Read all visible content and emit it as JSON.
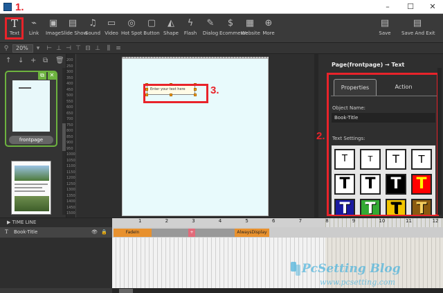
{
  "toolbar": {
    "items": [
      {
        "label": "Text",
        "icon": "text-icon",
        "glyph": "T"
      },
      {
        "label": "Link",
        "icon": "link-icon",
        "glyph": "⌁"
      },
      {
        "label": "Image",
        "icon": "image-icon",
        "glyph": "▣"
      },
      {
        "label": "Slide Show",
        "icon": "slideshow-icon",
        "glyph": "▤"
      },
      {
        "label": "Sound",
        "icon": "sound-icon",
        "glyph": "♫"
      },
      {
        "label": "Video",
        "icon": "video-icon",
        "glyph": "▭"
      },
      {
        "label": "Hot Spot",
        "icon": "hotspot-icon",
        "glyph": "◎"
      },
      {
        "label": "Button",
        "icon": "button-icon",
        "glyph": "▢"
      },
      {
        "label": "Shape",
        "icon": "shape-icon",
        "glyph": "◭"
      },
      {
        "label": "Flash",
        "icon": "flash-icon",
        "glyph": "ϟ"
      },
      {
        "label": "Dialog",
        "icon": "dialog-icon",
        "glyph": "✎"
      },
      {
        "label": "Ecommerce",
        "icon": "dollar-icon",
        "glyph": "$"
      },
      {
        "label": "Website",
        "icon": "website-icon",
        "glyph": "▦"
      },
      {
        "label": "More",
        "icon": "more-icon",
        "glyph": "⊕"
      }
    ],
    "save": {
      "label": "Save",
      "glyph": "▤"
    },
    "save_exit": {
      "label": "Save And Exit",
      "glyph": "▤"
    }
  },
  "window": {
    "minimize": "–",
    "maximize": "☐",
    "close": "✕"
  },
  "zoom": {
    "value": "20%"
  },
  "annotations": {
    "n1": "1.",
    "n2": "2.",
    "n3": "3."
  },
  "pages": {
    "page1_name": "frontpage"
  },
  "ruler_v": [
    "200",
    "250",
    "300",
    "350",
    "400",
    "450",
    "500",
    "550",
    "600",
    "650",
    "700",
    "750",
    "800",
    "850",
    "900",
    "950",
    "1000",
    "1050",
    "1100",
    "1150",
    "1200",
    "1250",
    "1300",
    "1350",
    "1400",
    "1450",
    "1500"
  ],
  "canvas": {
    "text_object": "Enter your text here"
  },
  "properties": {
    "title": "Page(frontpage) → Text",
    "tab_properties": "Properties",
    "tab_action": "Action",
    "object_name_label": "Object Name:",
    "object_name_value": "Book-Title",
    "text_settings_label": "Text Settings:"
  },
  "text_styles": [
    {
      "glyph": "T",
      "bg": "#ffffff",
      "fg": "#000000"
    },
    {
      "glyph": "T",
      "bg": "#ffffff",
      "fg": "#000000"
    },
    {
      "glyph": "T",
      "bg": "#ffffff",
      "fg": "#000000"
    },
    {
      "glyph": "T",
      "bg": "#ffffff",
      "fg": "#000000"
    },
    {
      "glyph": "T",
      "bg": "#ffffff",
      "fg": "#000000"
    },
    {
      "glyph": "T",
      "bg": "#ffffff",
      "fg": "#000000"
    },
    {
      "glyph": "T",
      "bg": "#000000",
      "fg": "#ffffff"
    },
    {
      "glyph": "T",
      "bg": "#ff0000",
      "fg": "#ffff00"
    },
    {
      "glyph": "T",
      "bg": "#1a1aa0",
      "fg": "#ffffff"
    },
    {
      "glyph": "T",
      "bg": "#33aa33",
      "fg": "#ffffff"
    },
    {
      "glyph": "T",
      "bg": "#f2c400",
      "fg": "#000000"
    },
    {
      "glyph": "T",
      "bg": "#8a5a10",
      "fg": "#f5d060"
    }
  ],
  "timeline": {
    "header": "TIME LINE",
    "row_label": "Book-Title",
    "ticks": [
      "1",
      "2",
      "3",
      "4",
      "5",
      "6",
      "7",
      "8",
      "9",
      "10",
      "11",
      "12"
    ],
    "segments": {
      "fadein": "FadeIn",
      "always": "AlwaysDisplay"
    }
  },
  "watermark": {
    "title": "PcSetting Blog",
    "url": "www.pcsetting.com"
  },
  "colors": {
    "highlight": "#e8232a",
    "page_border": "#6db33f",
    "timeline_segment": "#e8912e"
  }
}
